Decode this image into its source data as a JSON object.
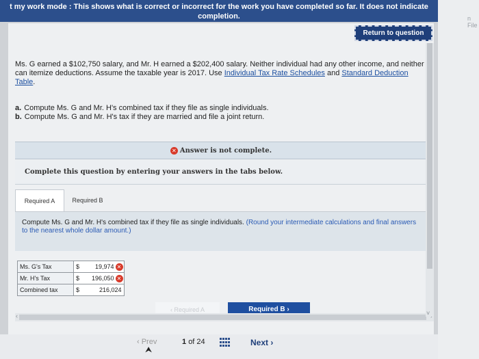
{
  "banner": {
    "line1": "t my work mode : This shows what is correct or incorrect for the work you have completed so far. It does not indicate",
    "line2": "completion."
  },
  "side": {
    "file_text": "n File"
  },
  "header": {
    "return_label": "Return to question"
  },
  "question": {
    "text": "Ms. G earned a $102,750 salary, and Mr. H earned a $202,400 salary. Neither individual had any other income, and neither can itemize deductions. Assume the taxable year is 2017. Use ",
    "link1": "Individual Tax Rate Schedules",
    "mid": " and ",
    "link2": "Standard Deduction Table",
    "end": "."
  },
  "parts": [
    {
      "letter": "a.",
      "text": "Compute Ms. G and Mr. H's combined tax if they file as single individuals."
    },
    {
      "letter": "b.",
      "text": "Compute Ms. G and Mr. H's tax if they are married and file a joint return."
    }
  ],
  "status": {
    "not_complete": "Answer is not complete.",
    "x_glyph": "✕"
  },
  "instructions": {
    "complete_question": "Complete this question by entering your answers in the tabs below."
  },
  "tabs": [
    {
      "label": "Required A",
      "active": true
    },
    {
      "label": "Required B",
      "active": false
    }
  ],
  "content": {
    "prompt": "Compute Ms. G and Mr. H's combined tax if they file as single individuals. ",
    "note": "(Round your intermediate calculations and final answers to the nearest whole dollar amount.)"
  },
  "table": {
    "rows": [
      {
        "label": "Ms. G's Tax",
        "currency": "$",
        "value": "19,974",
        "incorrect": true
      },
      {
        "label": "Mr. H's Tax",
        "currency": "$",
        "value": "196,050",
        "incorrect": true
      },
      {
        "label": "Combined tax",
        "currency": "$",
        "value": "216,024",
        "incorrect": false
      }
    ]
  },
  "nav": {
    "prev_tab": "‹  Required A",
    "next_tab": "Required B  ›"
  },
  "footer": {
    "prev": "‹  Prev",
    "page_current": "1",
    "page_of": "of 24",
    "next": "Next  ›"
  },
  "colors": {
    "banner": "#2c4f8c",
    "accent": "#1f4fa0",
    "error": "#d83a2a"
  }
}
